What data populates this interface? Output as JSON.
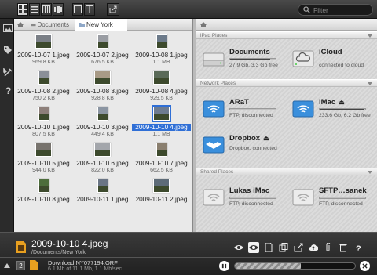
{
  "toolbar": {
    "filter_placeholder": "Filter"
  },
  "breadcrumb": {
    "items": [
      "Documents",
      "New York"
    ]
  },
  "files": [
    {
      "name": "2009-10-07 1.jpeg",
      "size": "969.8 KB"
    },
    {
      "name": "2009-10-07 2.jpeg",
      "size": "676.5 KB"
    },
    {
      "name": "2009-10-08 1.jpeg",
      "size": "1.1 MB"
    },
    {
      "name": "2009-10-08 2.jpeg",
      "size": "750.2 KB"
    },
    {
      "name": "2009-10-08 3.jpeg",
      "size": "928.8 KB"
    },
    {
      "name": "2009-10-08 4.jpeg",
      "size": "929.5 KB"
    },
    {
      "name": "2009-10-10 1.jpeg",
      "size": "807.5 KB"
    },
    {
      "name": "2009-10-10 3.jpeg",
      "size": "449.4 KB"
    },
    {
      "name": "2009-10-10 4.jpeg",
      "size": "1.1 MB"
    },
    {
      "name": "2009-10-10 5.jpeg",
      "size": "944.0 KB"
    },
    {
      "name": "2009-10-10 6.jpeg",
      "size": "822.0 KB"
    },
    {
      "name": "2009-10-10 7.jpeg",
      "size": "662.5 KB"
    },
    {
      "name": "2009-10-10 8.jpeg",
      "size": ""
    },
    {
      "name": "2009-10-11 1.jpeg",
      "size": ""
    },
    {
      "name": "2009-10-11 2.jpeg",
      "size": ""
    }
  ],
  "selected_file_index": 8,
  "places": {
    "ipad_header": "iPad Places",
    "network_header": "Network Places",
    "shared_header": "Shared Places",
    "ipad": [
      {
        "name": "Documents",
        "sub": "27.9 Gb, 3.3 Gb free",
        "usage": 0.88
      },
      {
        "name": "iCloud",
        "sub": "connected to cloud",
        "usage": null
      }
    ],
    "network": [
      {
        "name": "ARaT",
        "sub": "FTP, disconnected",
        "usage": null
      },
      {
        "name": "iMac",
        "sub": "233.6 Gb, 6.2 Gb free",
        "usage": 0.97,
        "eject": "⏏"
      },
      {
        "name": "Dropbox",
        "sub": "Dropbox, connected",
        "usage": null,
        "eject": "⏏"
      }
    ],
    "shared": [
      {
        "name": "Lukas iMac",
        "sub": "FTP, disconnected",
        "usage": null
      },
      {
        "name": "SFTP…sanek",
        "sub": "FTP, disconnected",
        "usage": null
      }
    ]
  },
  "current_file": {
    "name": "2009-10-10 4.jpeg",
    "path": "/Documents/New York"
  },
  "download": {
    "count": "2",
    "name": "Download NY077194.ORF",
    "progress_text": "6.1 Mb of 11.1 Mb, 1.1 Mb/sec",
    "fraction": 0.55
  },
  "colors": {
    "accent": "#2f6fd6",
    "network_icon": "#3a8fdc"
  }
}
